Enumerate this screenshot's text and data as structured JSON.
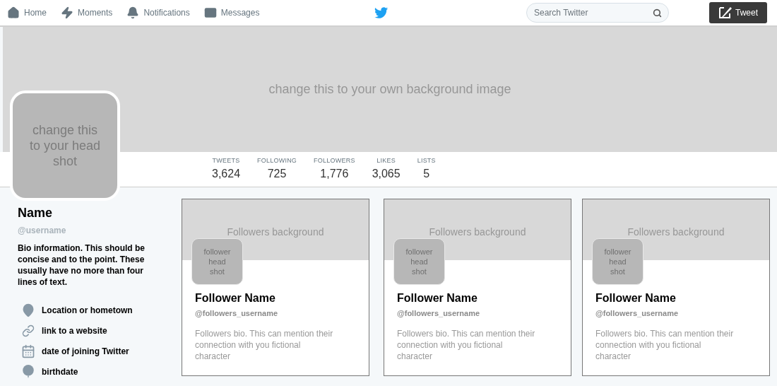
{
  "nav": [
    {
      "label": "Home"
    },
    {
      "label": "Moments"
    },
    {
      "label": "Notifications"
    },
    {
      "label": "Messages"
    }
  ],
  "search": {
    "placeholder": "Search Twitter"
  },
  "tweet_button": "Tweet",
  "banner": "change this to your own background image",
  "avatar": "change this to your head shot",
  "stats": [
    {
      "label": "TWEETS",
      "value": "3,624"
    },
    {
      "label": "FOLLOWING",
      "value": "725"
    },
    {
      "label": "FOLLOWERS",
      "value": "1,776"
    },
    {
      "label": "LIKES",
      "value": "3,065"
    },
    {
      "label": "LISTS",
      "value": "5"
    }
  ],
  "profile": {
    "name": "Name",
    "username": "@username",
    "bio": "Bio information. This should be concise and to the point. These usually have no more than four lines of text.",
    "details": [
      {
        "text": "Location or hometown"
      },
      {
        "text": "link to a website"
      },
      {
        "text": "date of joining Twitter"
      },
      {
        "text": "birthdate"
      }
    ]
  },
  "followers": [
    {
      "banner": "Followers background",
      "avatar": "follower head shot",
      "name": "Follower Name",
      "username": "@followers_username",
      "bio": "Followers bio. This can mention their connection with you fictional character"
    },
    {
      "banner": "Followers background",
      "avatar": "follower head shot",
      "name": "Follower Name",
      "username": "@followers_username",
      "bio": "Followers bio. This can mention their connection with you fictional character"
    },
    {
      "banner": "Followers background",
      "avatar": "follower head shot",
      "name": "Follower Name",
      "username": "@followers_username",
      "bio": "Followers bio. This can mention their connection with you fictional character"
    }
  ]
}
